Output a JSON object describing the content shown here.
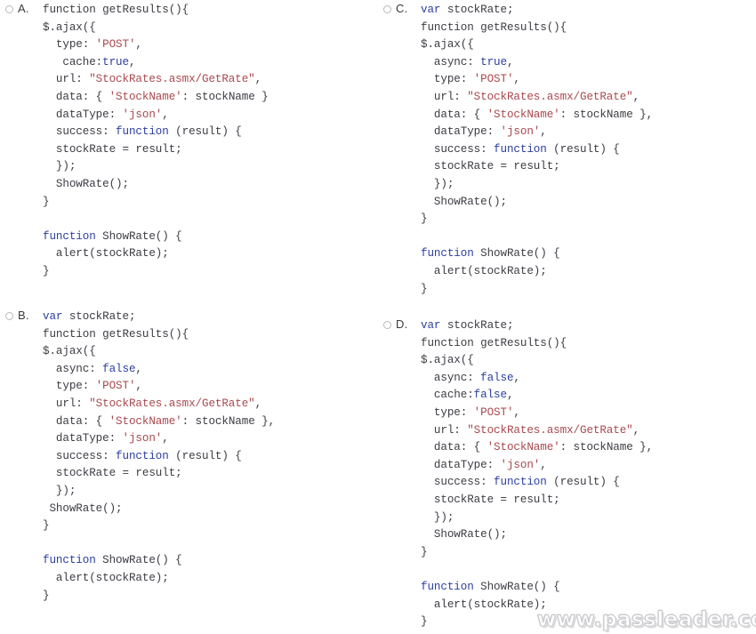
{
  "question": {
    "type": "multiple-choice-code",
    "watermark": "www.passleader.com"
  },
  "choices": [
    {
      "id": "A",
      "letter": "A.",
      "selected": false,
      "code_plain": "function getResults(){\n$.ajax({\n  type: 'POST',\n   cache:true,\n  url: \"StockRates.asmx/GetRate\",\n  data: { 'StockName': stockName }\n  dataType: 'json',\n  success: function (result) {\n  stockRate = result;\n  });\n  ShowRate();\n}\n\nfunction ShowRate() {\n  alert(stockRate);\n}",
      "lines": [
        [
          {
            "t": "function getResults(){",
            "c": "pl"
          }
        ],
        [
          {
            "t": "$.ajax({",
            "c": "pl"
          }
        ],
        [
          {
            "t": "  type: ",
            "c": "pl"
          },
          {
            "t": "'POST'",
            "c": "str"
          },
          {
            "t": ",",
            "c": "pl"
          }
        ],
        [
          {
            "t": "   cache:",
            "c": "pl"
          },
          {
            "t": "true",
            "c": "kw"
          },
          {
            "t": ",",
            "c": "pl"
          }
        ],
        [
          {
            "t": "  url: ",
            "c": "pl"
          },
          {
            "t": "\"StockRates.asmx/GetRate\"",
            "c": "str"
          },
          {
            "t": ",",
            "c": "pl"
          }
        ],
        [
          {
            "t": "  data: { ",
            "c": "pl"
          },
          {
            "t": "'StockName'",
            "c": "str"
          },
          {
            "t": ": stockName }",
            "c": "pl"
          }
        ],
        [
          {
            "t": "  dataType: ",
            "c": "pl"
          },
          {
            "t": "'json'",
            "c": "str"
          },
          {
            "t": ",",
            "c": "pl"
          }
        ],
        [
          {
            "t": "  success: ",
            "c": "pl"
          },
          {
            "t": "function",
            "c": "kw"
          },
          {
            "t": " (result) {",
            "c": "pl"
          }
        ],
        [
          {
            "t": "  stockRate = result;",
            "c": "pl"
          }
        ],
        [
          {
            "t": "  });",
            "c": "pl"
          }
        ],
        [
          {
            "t": "  ShowRate();",
            "c": "pl"
          }
        ],
        [
          {
            "t": "}",
            "c": "pl"
          }
        ],
        [
          {
            "t": "",
            "c": "pl"
          }
        ],
        [
          {
            "t": "function",
            "c": "kw"
          },
          {
            "t": " ShowRate() {",
            "c": "pl"
          }
        ],
        [
          {
            "t": "  alert(stockRate);",
            "c": "pl"
          }
        ],
        [
          {
            "t": "}",
            "c": "pl"
          }
        ]
      ]
    },
    {
      "id": "B",
      "letter": "B.",
      "selected": false,
      "code_plain": "var stockRate;\nfunction getResults(){\n$.ajax({\n  async: false,\n  type: 'POST',\n  url: \"StockRates.asmx/GetRate\",\n  data: { 'StockName': stockName },\n  dataType: 'json',\n  success: function (result) {\n  stockRate = result;\n  });\n ShowRate();\n}\n\nfunction ShowRate() {\n  alert(stockRate);\n}",
      "lines": [
        [
          {
            "t": "var",
            "c": "kw"
          },
          {
            "t": " stockRate;",
            "c": "pl"
          }
        ],
        [
          {
            "t": "function getResults(){",
            "c": "pl"
          }
        ],
        [
          {
            "t": "$.ajax({",
            "c": "pl"
          }
        ],
        [
          {
            "t": "  async: ",
            "c": "pl"
          },
          {
            "t": "false",
            "c": "kw"
          },
          {
            "t": ",",
            "c": "pl"
          }
        ],
        [
          {
            "t": "  type: ",
            "c": "pl"
          },
          {
            "t": "'POST'",
            "c": "str"
          },
          {
            "t": ",",
            "c": "pl"
          }
        ],
        [
          {
            "t": "  url: ",
            "c": "pl"
          },
          {
            "t": "\"StockRates.asmx/GetRate\"",
            "c": "str"
          },
          {
            "t": ",",
            "c": "pl"
          }
        ],
        [
          {
            "t": "  data: { ",
            "c": "pl"
          },
          {
            "t": "'StockName'",
            "c": "str"
          },
          {
            "t": ": stockName },",
            "c": "pl"
          }
        ],
        [
          {
            "t": "  dataType: ",
            "c": "pl"
          },
          {
            "t": "'json'",
            "c": "str"
          },
          {
            "t": ",",
            "c": "pl"
          }
        ],
        [
          {
            "t": "  success: ",
            "c": "pl"
          },
          {
            "t": "function",
            "c": "kw"
          },
          {
            "t": " (result) {",
            "c": "pl"
          }
        ],
        [
          {
            "t": "  stockRate = result;",
            "c": "pl"
          }
        ],
        [
          {
            "t": "  });",
            "c": "pl"
          }
        ],
        [
          {
            "t": " ShowRate();",
            "c": "pl"
          }
        ],
        [
          {
            "t": "}",
            "c": "pl"
          }
        ],
        [
          {
            "t": "",
            "c": "pl"
          }
        ],
        [
          {
            "t": "function",
            "c": "kw"
          },
          {
            "t": " ShowRate() {",
            "c": "pl"
          }
        ],
        [
          {
            "t": "  alert(stockRate);",
            "c": "pl"
          }
        ],
        [
          {
            "t": "}",
            "c": "pl"
          }
        ]
      ]
    },
    {
      "id": "C",
      "letter": "C.",
      "selected": false,
      "code_plain": "var stockRate;\nfunction getResults(){\n$.ajax({\n  async: true,\n  type: 'POST',\n  url: \"StockRates.asmx/GetRate\",\n  data: { 'StockName': stockName },\n  dataType: 'json',\n  success: function (result) {\n  stockRate = result;\n  });\n  ShowRate();\n}\n\nfunction ShowRate() {\n  alert(stockRate);\n}",
      "lines": [
        [
          {
            "t": "var",
            "c": "kw"
          },
          {
            "t": " stockRate;",
            "c": "pl"
          }
        ],
        [
          {
            "t": "function getResults(){",
            "c": "pl"
          }
        ],
        [
          {
            "t": "$.ajax({",
            "c": "pl"
          }
        ],
        [
          {
            "t": "  async: ",
            "c": "pl"
          },
          {
            "t": "true",
            "c": "kw"
          },
          {
            "t": ",",
            "c": "pl"
          }
        ],
        [
          {
            "t": "  type: ",
            "c": "pl"
          },
          {
            "t": "'POST'",
            "c": "str"
          },
          {
            "t": ",",
            "c": "pl"
          }
        ],
        [
          {
            "t": "  url: ",
            "c": "pl"
          },
          {
            "t": "\"StockRates.asmx/GetRate\"",
            "c": "str"
          },
          {
            "t": ",",
            "c": "pl"
          }
        ],
        [
          {
            "t": "  data: { ",
            "c": "pl"
          },
          {
            "t": "'StockName'",
            "c": "str"
          },
          {
            "t": ": stockName },",
            "c": "pl"
          }
        ],
        [
          {
            "t": "  dataType: ",
            "c": "pl"
          },
          {
            "t": "'json'",
            "c": "str"
          },
          {
            "t": ",",
            "c": "pl"
          }
        ],
        [
          {
            "t": "  success: ",
            "c": "pl"
          },
          {
            "t": "function",
            "c": "kw"
          },
          {
            "t": " (result) {",
            "c": "pl"
          }
        ],
        [
          {
            "t": "  stockRate = result;",
            "c": "pl"
          }
        ],
        [
          {
            "t": "  });",
            "c": "pl"
          }
        ],
        [
          {
            "t": "  ShowRate();",
            "c": "pl"
          }
        ],
        [
          {
            "t": "}",
            "c": "pl"
          }
        ],
        [
          {
            "t": "",
            "c": "pl"
          }
        ],
        [
          {
            "t": "function",
            "c": "kw"
          },
          {
            "t": " ShowRate() {",
            "c": "pl"
          }
        ],
        [
          {
            "t": "  alert(stockRate);",
            "c": "pl"
          }
        ],
        [
          {
            "t": "}",
            "c": "pl"
          }
        ]
      ]
    },
    {
      "id": "D",
      "letter": "D.",
      "selected": false,
      "code_plain": "var stockRate;\nfunction getResults(){\n$.ajax({\n  async: false,\n  cache:false,\n  type: 'POST',\n  url: \"StockRates.asmx/GetRate\",\n  data: { 'StockName': stockName },\n  dataType: 'json',\n  success: function (result) {\n  stockRate = result;\n  });\n  ShowRate();\n}\n\nfunction ShowRate() {\n  alert(stockRate);\n}",
      "lines": [
        [
          {
            "t": "var",
            "c": "kw"
          },
          {
            "t": " stockRate;",
            "c": "pl"
          }
        ],
        [
          {
            "t": "function getResults(){",
            "c": "pl"
          }
        ],
        [
          {
            "t": "$.ajax({",
            "c": "pl"
          }
        ],
        [
          {
            "t": "  async: ",
            "c": "pl"
          },
          {
            "t": "false",
            "c": "kw"
          },
          {
            "t": ",",
            "c": "pl"
          }
        ],
        [
          {
            "t": "  cache:",
            "c": "pl"
          },
          {
            "t": "false",
            "c": "kw"
          },
          {
            "t": ",",
            "c": "pl"
          }
        ],
        [
          {
            "t": "  type: ",
            "c": "pl"
          },
          {
            "t": "'POST'",
            "c": "str"
          },
          {
            "t": ",",
            "c": "pl"
          }
        ],
        [
          {
            "t": "  url: ",
            "c": "pl"
          },
          {
            "t": "\"StockRates.asmx/GetRate\"",
            "c": "str"
          },
          {
            "t": ",",
            "c": "pl"
          }
        ],
        [
          {
            "t": "  data: { ",
            "c": "pl"
          },
          {
            "t": "'StockName'",
            "c": "str"
          },
          {
            "t": ": stockName },",
            "c": "pl"
          }
        ],
        [
          {
            "t": "  dataType: ",
            "c": "pl"
          },
          {
            "t": "'json'",
            "c": "str"
          },
          {
            "t": ",",
            "c": "pl"
          }
        ],
        [
          {
            "t": "  success: ",
            "c": "pl"
          },
          {
            "t": "function",
            "c": "kw"
          },
          {
            "t": " (result) {",
            "c": "pl"
          }
        ],
        [
          {
            "t": "  stockRate = result;",
            "c": "pl"
          }
        ],
        [
          {
            "t": "  });",
            "c": "pl"
          }
        ],
        [
          {
            "t": "  ShowRate();",
            "c": "pl"
          }
        ],
        [
          {
            "t": "}",
            "c": "pl"
          }
        ],
        [
          {
            "t": "",
            "c": "pl"
          }
        ],
        [
          {
            "t": "function",
            "c": "kw"
          },
          {
            "t": " ShowRate() {",
            "c": "pl"
          }
        ],
        [
          {
            "t": "  alert(stockRate);",
            "c": "pl"
          }
        ],
        [
          {
            "t": "}",
            "c": "pl"
          }
        ]
      ]
    }
  ],
  "colors": {
    "keyword": "#2b3fa0",
    "string": "#a8494f",
    "plain": "#3c3c44",
    "radio_border": "#b9b9bd",
    "background": "#ffffff",
    "watermark": "#d6d6da"
  }
}
